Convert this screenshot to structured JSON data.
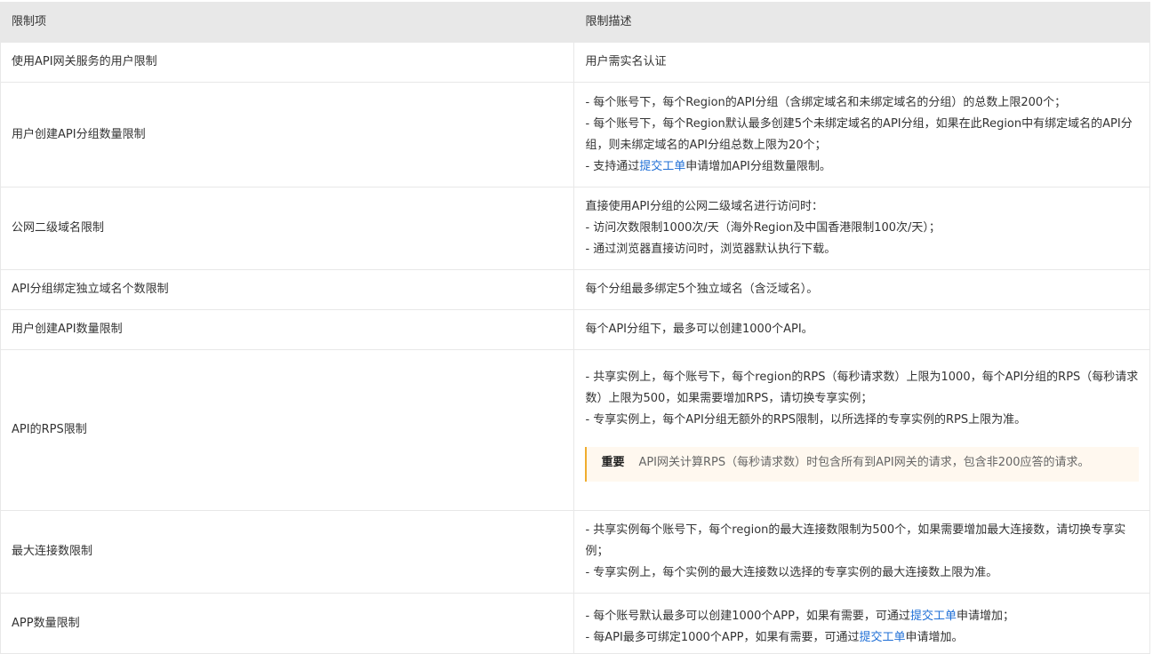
{
  "table": {
    "headers": {
      "item": "限制项",
      "desc": "限制描述"
    },
    "rows": [
      {
        "item": "使用API网关服务的用户限制",
        "desc": [
          "用户需实名认证"
        ]
      },
      {
        "item": "用户创建API分组数量限制",
        "desc": [
          "- 每个账号下，每个Region的API分组（含绑定域名和未绑定域名的分组）的总数上限200个；",
          "- 每个账号下，每个Region默认最多创建5个未绑定域名的API分组，如果在此Region中有绑定域名的API分组，则未绑定域名的API分组总数上限为20个；"
        ],
        "desc_link_line": {
          "before": "- 支持通过",
          "link": "提交工单",
          "after": "申请增加API分组数量限制。"
        }
      },
      {
        "item": "公网二级域名限制",
        "desc": [
          "直接使用API分组的公网二级域名进行访问时：",
          "- 访问次数限制1000次/天（海外Region及中国香港限制100次/天）；",
          "- 通过浏览器直接访问时，浏览器默认执行下载。"
        ]
      },
      {
        "item": "API分组绑定独立域名个数限制",
        "desc": [
          "每个分组最多绑定5个独立域名（含泛域名）。"
        ]
      },
      {
        "item": "用户创建API数量限制",
        "desc": [
          "每个API分组下，最多可以创建1000个API。"
        ]
      },
      {
        "item": "API的RPS限制",
        "desc": [
          "- 共享实例上，每个账号下，每个region的RPS（每秒请求数）上限为1000，每个API分组的RPS（每秒请求数）上限为500，如果需要增加RPS，请切换专享实例；",
          "- 专享实例上，每个API分组无额外的RPS限制，以所选择的专享实例的RPS上限为准。"
        ],
        "note": {
          "title": "重要",
          "text": "API网关计算RPS（每秒请求数）时包含所有到API网关的请求，包含非200应答的请求。"
        }
      },
      {
        "item": "最大连接数限制",
        "desc": [
          "- 共享实例每个账号下，每个region的最大连接数限制为500个，如果需要增加最大连接数，请切换专享实例；",
          "- 专享实例上，每个实例的最大连接数以选择的专享实例的最大连接数上限为准。"
        ]
      },
      {
        "item": "APP数量限制",
        "desc_link_lines": [
          {
            "before": "- 每个账号默认最多可以创建1000个APP，如果有需要，可通过",
            "link": "提交工单",
            "after": "申请增加；"
          },
          {
            "before": "- 每API最多可绑定1000个APP，如果有需要，可通过",
            "link": "提交工单",
            "after": "申请增加。"
          }
        ]
      }
    ]
  }
}
